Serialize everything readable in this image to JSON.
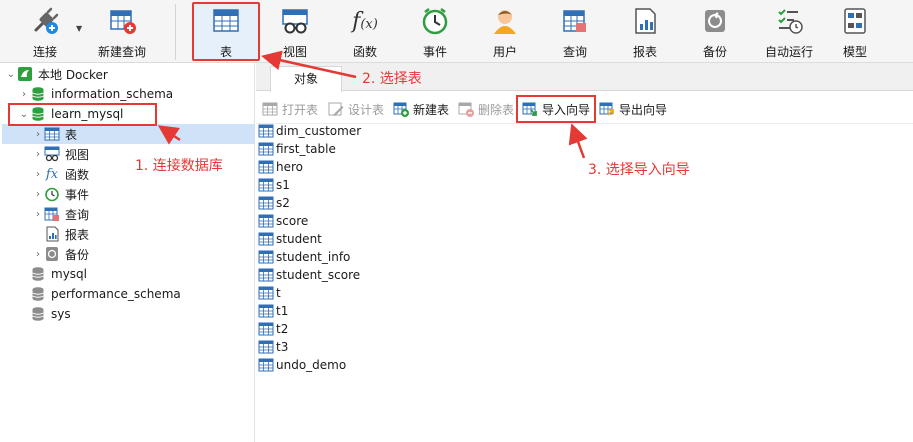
{
  "toolbar": {
    "items": [
      {
        "label": "连接",
        "icon": "plug-icon"
      },
      {
        "label": "新建查询",
        "icon": "new-query-icon"
      },
      {
        "label": "表",
        "icon": "table-icon",
        "selected": true
      },
      {
        "label": "视图",
        "icon": "view-icon"
      },
      {
        "label": "函数",
        "icon": "function-icon"
      },
      {
        "label": "事件",
        "icon": "clock-icon"
      },
      {
        "label": "用户",
        "icon": "user-icon"
      },
      {
        "label": "查询",
        "icon": "query-icon"
      },
      {
        "label": "报表",
        "icon": "report-icon"
      },
      {
        "label": "备份",
        "icon": "backup-icon"
      },
      {
        "label": "自动运行",
        "icon": "schedule-icon"
      },
      {
        "label": "模型",
        "icon": "model-icon"
      }
    ]
  },
  "tree": {
    "connection": "本地 Docker",
    "databases": [
      "information_schema",
      "learn_mysql",
      "mysql",
      "performance_schema",
      "sys"
    ],
    "children": [
      "表",
      "视图",
      "函数",
      "事件",
      "查询",
      "报表",
      "备份"
    ]
  },
  "tabs": [
    "对象"
  ],
  "object_toolbar": {
    "open": "打开表",
    "design": "设计表",
    "new": "新建表",
    "delete": "删除表",
    "import": "导入向导",
    "export": "导出向导"
  },
  "tables": [
    "dim_customer",
    "first_table",
    "hero",
    "s1",
    "s2",
    "score",
    "student",
    "student_info",
    "student_score",
    "t",
    "t1",
    "t2",
    "t3",
    "undo_demo"
  ],
  "annotations": {
    "step1": "1. 连接数据库",
    "step2": "2. 选择表",
    "step3": "3. 选择导入向导"
  },
  "colors": {
    "highlight": "#e53935",
    "selection": "#cfe2f7",
    "table_icon_blue": "#2f6fb5",
    "db_green": "#2e9e3f"
  }
}
